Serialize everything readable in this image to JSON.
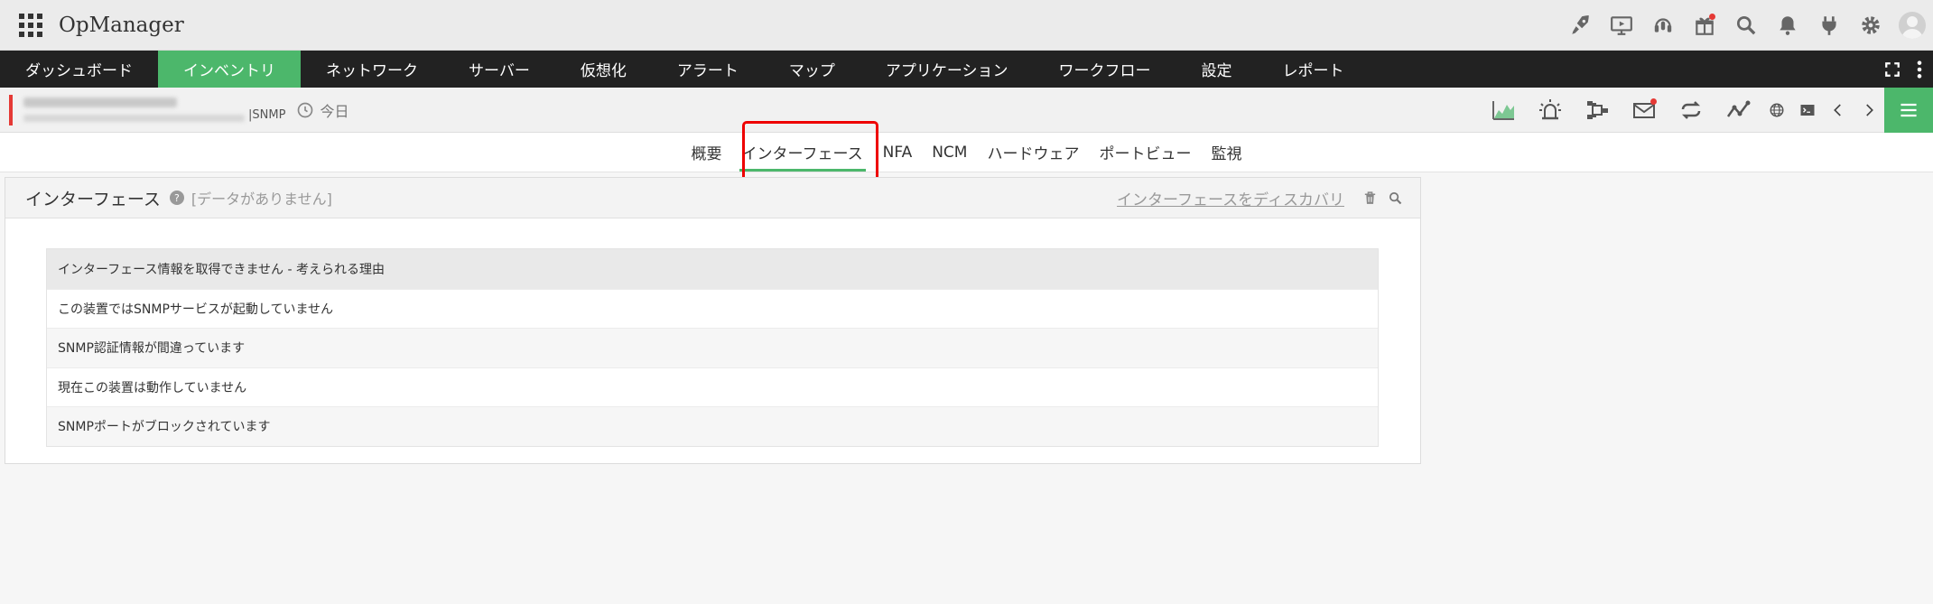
{
  "app": {
    "name": "OpManager"
  },
  "main_nav": {
    "items": [
      "ダッシュボード",
      "インベントリ",
      "ネットワーク",
      "サーバー",
      "仮想化",
      "アラート",
      "マップ",
      "アプリケーション",
      "ワークフロー",
      "設定",
      "レポート"
    ],
    "active": "インベントリ"
  },
  "device": {
    "protocol": "SNMP",
    "time_range": "今日"
  },
  "sub_tabs": {
    "items": [
      "概要",
      "インターフェース",
      "NFA",
      "NCM",
      "ハードウェア",
      "ポートビュー",
      "監視"
    ],
    "active": "インターフェース"
  },
  "panel": {
    "title": "インターフェース",
    "help": "?",
    "status": "[データがありません]",
    "discover_link": "インターフェースをディスカバリ"
  },
  "reasons": {
    "header": "インターフェース情報を取得できません - 考えられる理由",
    "items": [
      "この装置ではSNMPサービスが起動していません",
      "SNMP認証情報が間違っています",
      "現在この装置は動作していません",
      "SNMPポートがブロックされています"
    ]
  },
  "colors": {
    "accent": "#4cb76b",
    "nav_bg": "#222222",
    "highlight": "#e00000",
    "alert": "#e53935"
  }
}
